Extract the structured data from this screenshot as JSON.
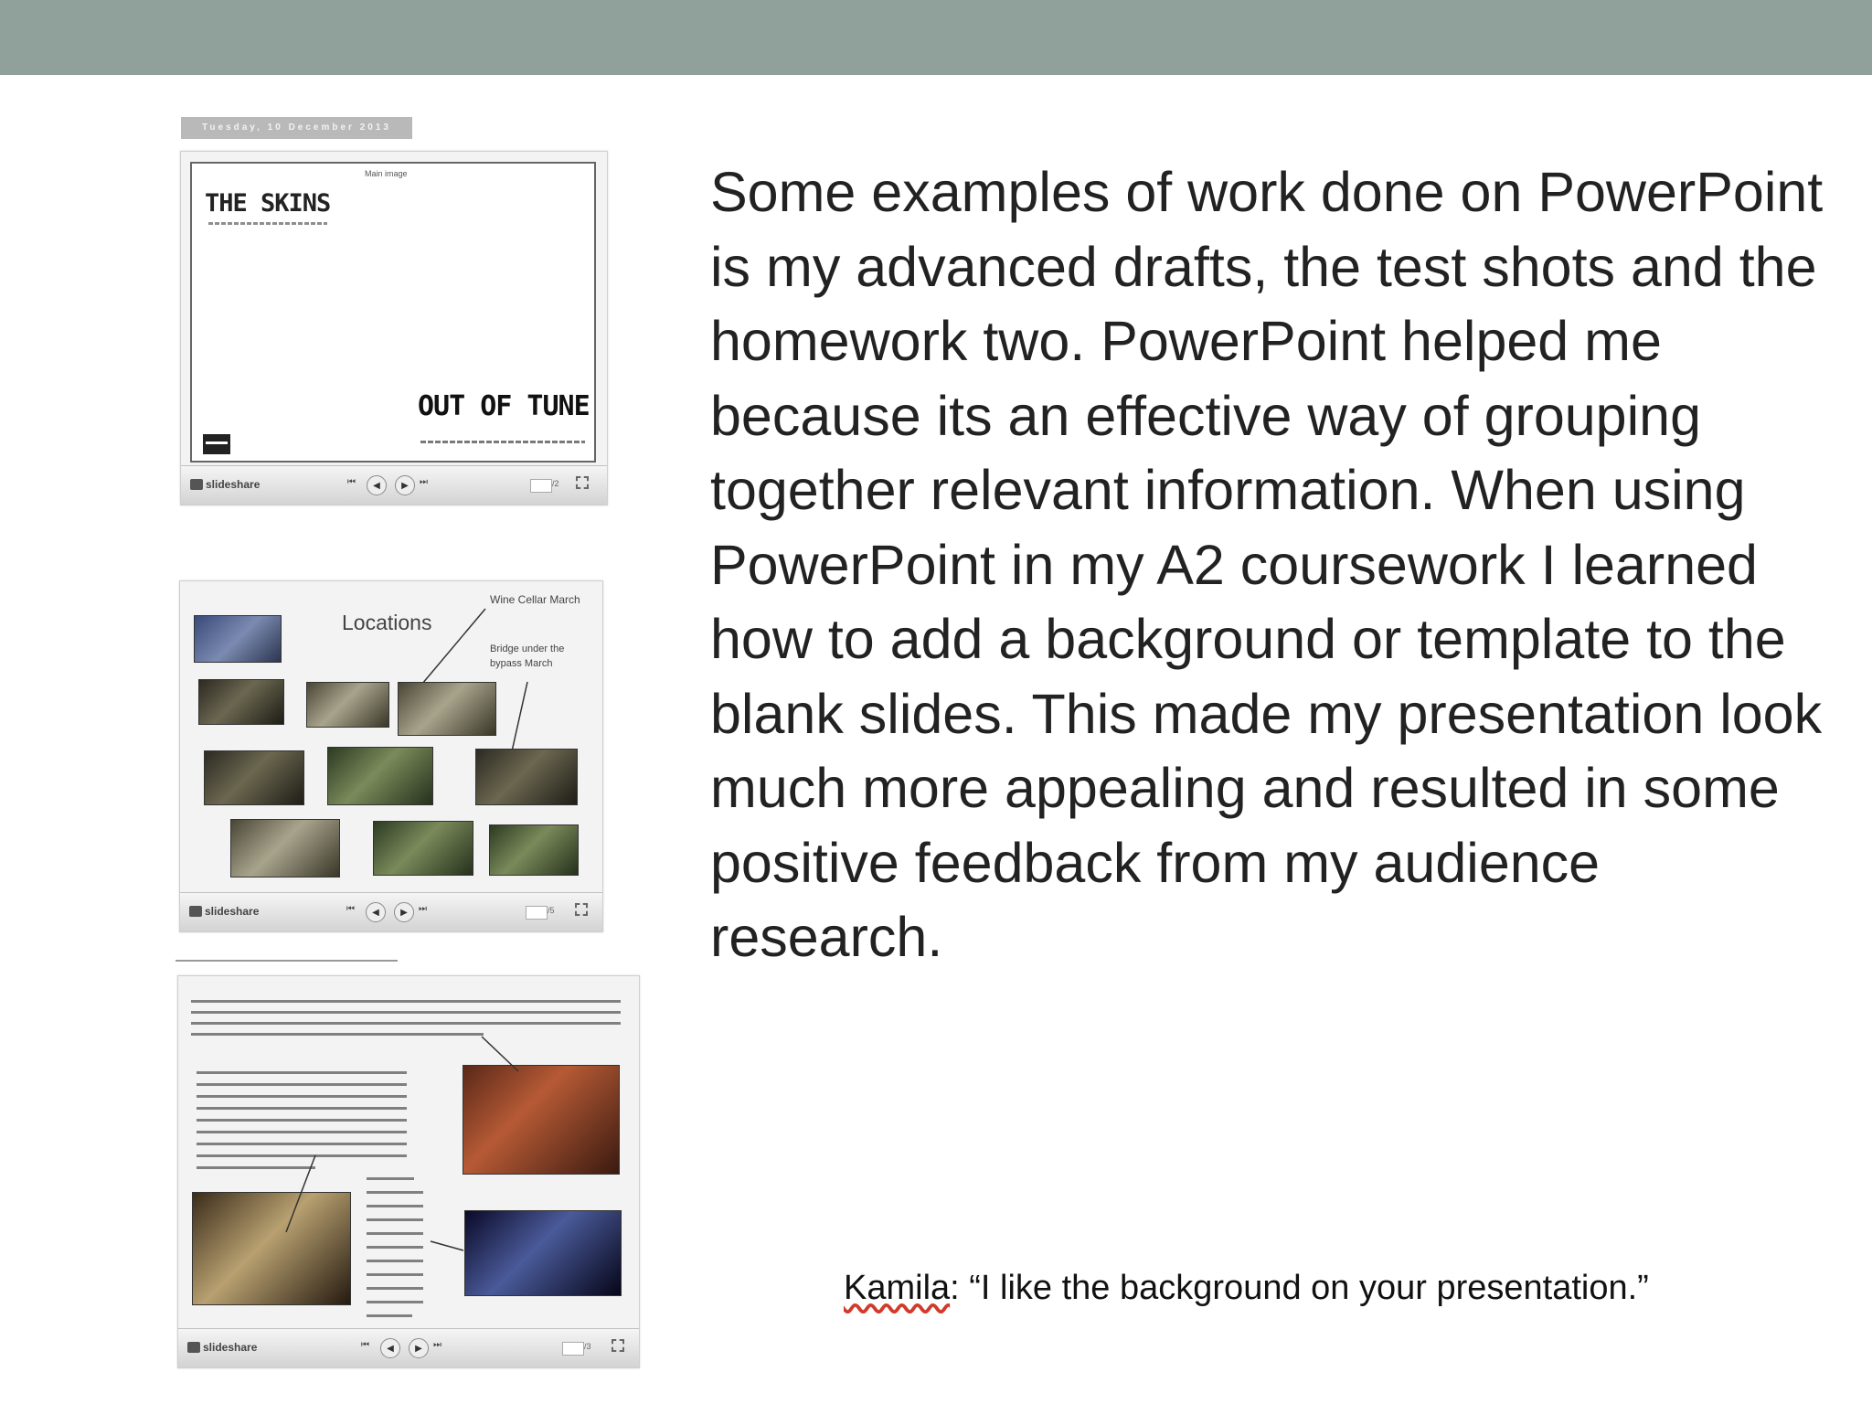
{
  "main_text": "Some examples of work done on PowerPoint is my advanced drafts, the test shots and the homework two. PowerPoint helped me because its an effective way of grouping together relevant information. When using PowerPoint in my A2 coursework I learned how to add a background or template to the blank slides. This made my presentation look much more appealing and resulted in some positive feedback from my audience research.",
  "quote": {
    "name": "Kamila",
    "text": ": “I like the background on your presentation.”"
  },
  "thumb1": {
    "date": "Tuesday, 10 December 2013",
    "main_image_label": "Main image",
    "band_logo": "THE SKINS",
    "album_title": "OUT OF TUNE"
  },
  "thumb2": {
    "title": "Locations",
    "note1": "Wine Cellar March",
    "note2": "Bridge under the bypass March"
  },
  "player": {
    "brand": "slideshare",
    "first": "⏮",
    "prev": "◀",
    "next": "▶",
    "last": "⏭",
    "total_1": "/2",
    "total_2": "/5",
    "total_3": "/3"
  },
  "colors": {
    "top_bar": "#8fa19a",
    "text": "#222222",
    "spellcheck": "#d23a2a"
  }
}
